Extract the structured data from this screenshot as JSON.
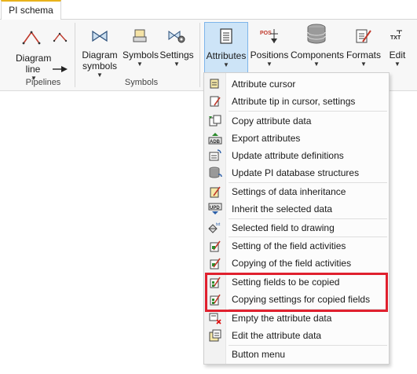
{
  "tab": {
    "label": "PI schema"
  },
  "ribbon": {
    "groups": [
      {
        "label": "Pipelines"
      },
      {
        "label": "Symbols"
      }
    ],
    "buttons": {
      "diagram_line": "Diagram line",
      "diagram_symbols": "Diagram symbols",
      "symbols": "Symbols",
      "settings": "Settings",
      "attributes": "Attributes",
      "positions": "Positions",
      "components": "Components",
      "formats": "Formats",
      "edit": "Edit"
    },
    "icon_text": {
      "pos": "POS",
      "txt": "TXT"
    }
  },
  "menu": {
    "items": [
      {
        "label": "Attribute cursor",
        "icon": "attribute-cursor-icon"
      },
      {
        "label": "Attribute tip in cursor, settings",
        "icon": "attribute-tip-icon"
      },
      {
        "label": "Copy attribute data",
        "icon": "copy-data-icon"
      },
      {
        "label": "Export attributes",
        "icon": "export-icon"
      },
      {
        "label": "Update attribute definitions",
        "icon": "update-definitions-icon"
      },
      {
        "label": "Update PI database structures",
        "icon": "database-update-icon"
      },
      {
        "label": "Settings of data inheritance",
        "icon": "inheritance-settings-icon"
      },
      {
        "label": "Inherit the selected data",
        "icon": "inherit-icon"
      },
      {
        "label": "Selected field to drawing",
        "icon": "field-to-drawing-icon"
      },
      {
        "label": "Setting of the field activities",
        "icon": "field-activities-setting-icon"
      },
      {
        "label": "Copying of the field activities",
        "icon": "field-activities-copy-icon"
      },
      {
        "label": "Setting fields to be copied",
        "icon": "fields-copied-setting-icon"
      },
      {
        "label": "Copying settings for copied fields",
        "icon": "copied-fields-settings-icon"
      },
      {
        "label": "Empty the attribute data",
        "icon": "empty-data-icon"
      },
      {
        "label": "Edit the attribute data",
        "icon": "edit-data-icon"
      },
      {
        "label": "Button menu",
        "icon": ""
      }
    ],
    "icon_text": {
      "export": "ADB",
      "inherit": "UPD",
      "txt": "txt"
    }
  },
  "colors": {
    "highlight": "#e0202e",
    "accent_tab": "#e8b21a",
    "active_button": "#cde4f7"
  }
}
